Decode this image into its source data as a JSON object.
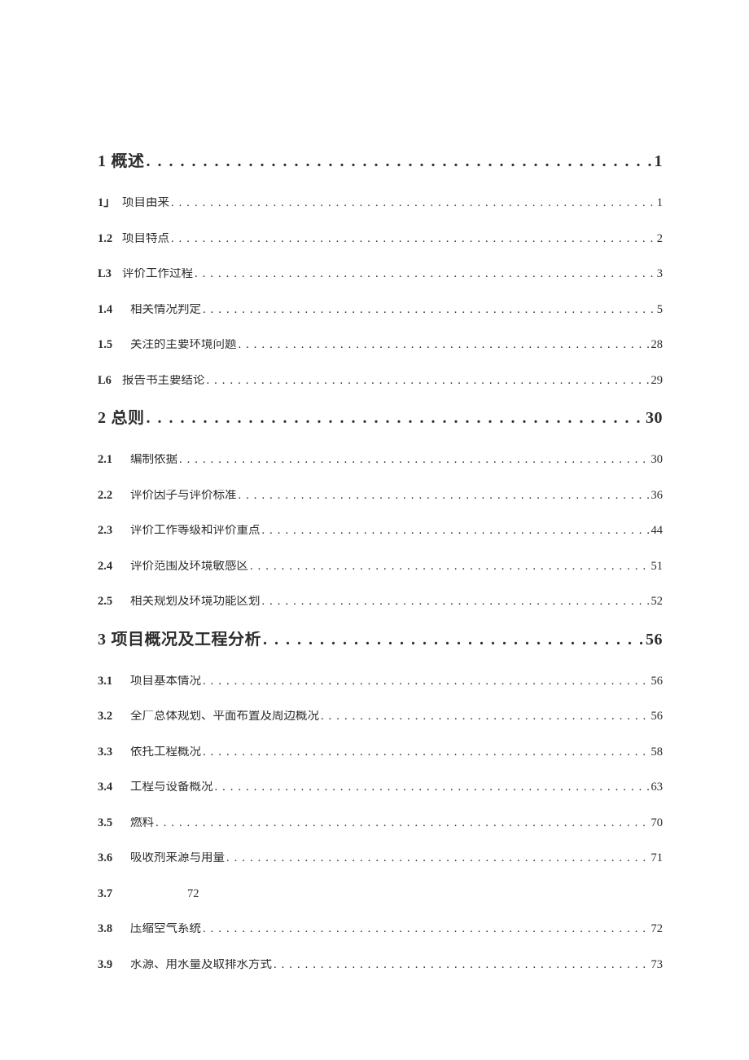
{
  "toc": [
    {
      "kind": "major",
      "num": "1",
      "label": "概述",
      "page": "1"
    },
    {
      "kind": "minor",
      "num": "1」",
      "numTight": true,
      "label": "项目由来",
      "page": "1"
    },
    {
      "kind": "minor",
      "num": "1.2",
      "numTight": true,
      "label": "项目特点",
      "page": "2"
    },
    {
      "kind": "minor",
      "num": "L3",
      "numTight": true,
      "label": "评价工作过程",
      "page": "3"
    },
    {
      "kind": "minor",
      "num": "1.4",
      "label": "相关情况判定",
      "page": "5"
    },
    {
      "kind": "minor",
      "num": "1.5",
      "label": "关注的主要环境问题",
      "page": "28"
    },
    {
      "kind": "minor",
      "num": "L6",
      "numTight": true,
      "label": "报告书主要结论",
      "page": "29"
    },
    {
      "kind": "major",
      "num": "2",
      "label": "总则",
      "page": "30"
    },
    {
      "kind": "minor",
      "num": "2.1",
      "label": "编制依据",
      "page": "30"
    },
    {
      "kind": "minor",
      "num": "2.2",
      "label": "评价因子与评价标准",
      "page": "36"
    },
    {
      "kind": "minor",
      "num": "2.3",
      "label": "评价工作等级和评价重点",
      "page": "44"
    },
    {
      "kind": "minor",
      "num": "2.4",
      "label": "评价范围及环境敏感区",
      "page": "51"
    },
    {
      "kind": "minor",
      "num": "2.5",
      "label": "相关规划及环境功能区划",
      "page": "52"
    },
    {
      "kind": "major",
      "num": "3",
      "label": "项目概况及工程分析",
      "page": "56"
    },
    {
      "kind": "minor",
      "num": "3.1",
      "label": "项目基本情况",
      "page": "56"
    },
    {
      "kind": "minor",
      "num": "3.2",
      "label": "全厂总体规划、平面布置及周边概况",
      "page": "56"
    },
    {
      "kind": "minor",
      "num": "3.3",
      "label": "依托工程概况",
      "page": "58"
    },
    {
      "kind": "minor",
      "num": "3.4",
      "label": "工程与设备概况",
      "page": "63"
    },
    {
      "kind": "minor",
      "num": "3.5",
      "label": "燃料",
      "page": "70"
    },
    {
      "kind": "minor",
      "num": "3.6",
      "label": "吸收剂来源与用量",
      "page": "71"
    },
    {
      "kind": "minor",
      "num": "3.7",
      "label": "",
      "page": "72",
      "noDots": true
    },
    {
      "kind": "minor",
      "num": "3.8",
      "label": "压缩空气系统",
      "page": "72"
    },
    {
      "kind": "minor",
      "num": "3.9",
      "label": "水源、用水量及取排水方式",
      "page": "73"
    }
  ]
}
